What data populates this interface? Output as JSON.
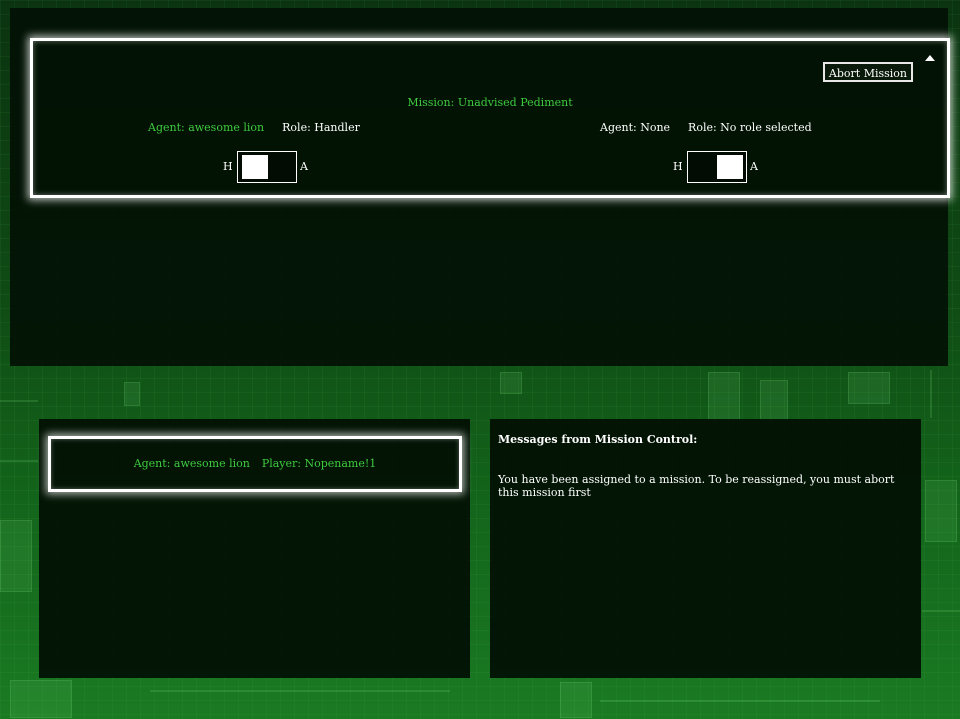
{
  "mission": {
    "abort_label": "Abort Mission",
    "title": "Mission: Unadvised Pediment",
    "left": {
      "agent": "Agent: awesome lion",
      "role": "Role: Handler",
      "slider_left_label": "H",
      "slider_right_label": "A"
    },
    "right": {
      "agent": "Agent: None",
      "role": "Role: No role selected",
      "slider_left_label": "H",
      "slider_right_label": "A"
    }
  },
  "player": {
    "agent": "Agent: awesome lion",
    "player": "Player: Nopename!1"
  },
  "messages": {
    "title": "Messages from Mission Control:",
    "body": "You have been assigned to a mission. To be reassigned, you must abort this mission first"
  },
  "colors": {
    "accent_green": "#3fca3f",
    "panel_bg": "#020e03",
    "border": "#ffffff"
  },
  "icons": {
    "collapse": "triangle-up-icon"
  }
}
